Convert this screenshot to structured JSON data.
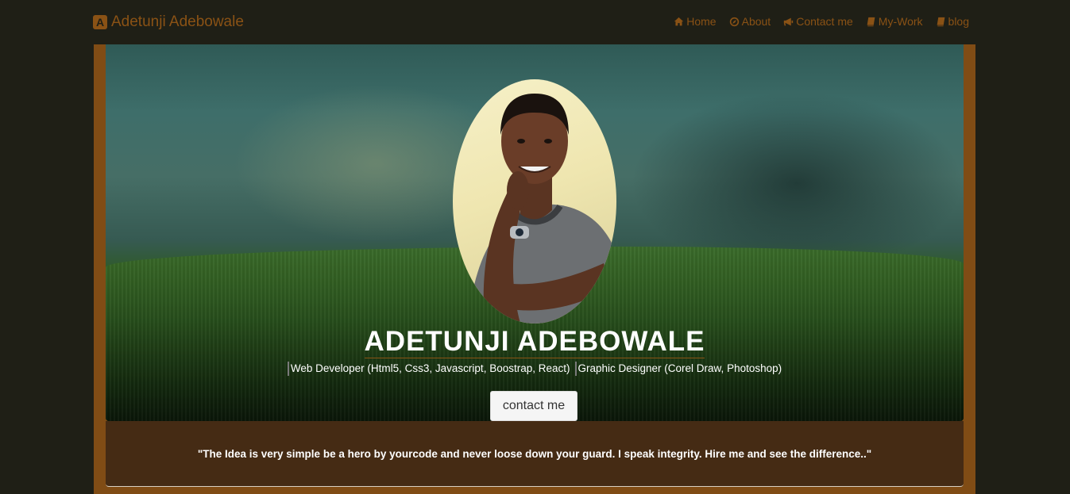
{
  "navbar": {
    "brand_icon_letter": "A",
    "brand": "Adetunji Adebowale",
    "links": [
      {
        "icon": "home-icon",
        "label": "Home"
      },
      {
        "icon": "compass-icon",
        "label": "About"
      },
      {
        "icon": "bullhorn-icon",
        "label": "Contact me"
      },
      {
        "icon": "book-icon",
        "label": "My-Work"
      },
      {
        "icon": "book-icon",
        "label": "blog"
      }
    ]
  },
  "hero": {
    "name": "ADETUNJI ADEBOWALE",
    "roles": [
      "Web Developer (Html5, Css3, Javascript, Boostrap, React)",
      "Graphic Designer (Corel Draw, Photoshop)"
    ],
    "button_label": "contact me"
  },
  "quote": {
    "text": "\"The Idea is very simple be a hero by yourcode and never loose down your guard. I speak integrity. Hire me and see the difference..\""
  },
  "colors": {
    "background": "#1f1f16",
    "accent": "#8a5215",
    "frame": "#804c15",
    "quote_bg": "#452b14"
  }
}
